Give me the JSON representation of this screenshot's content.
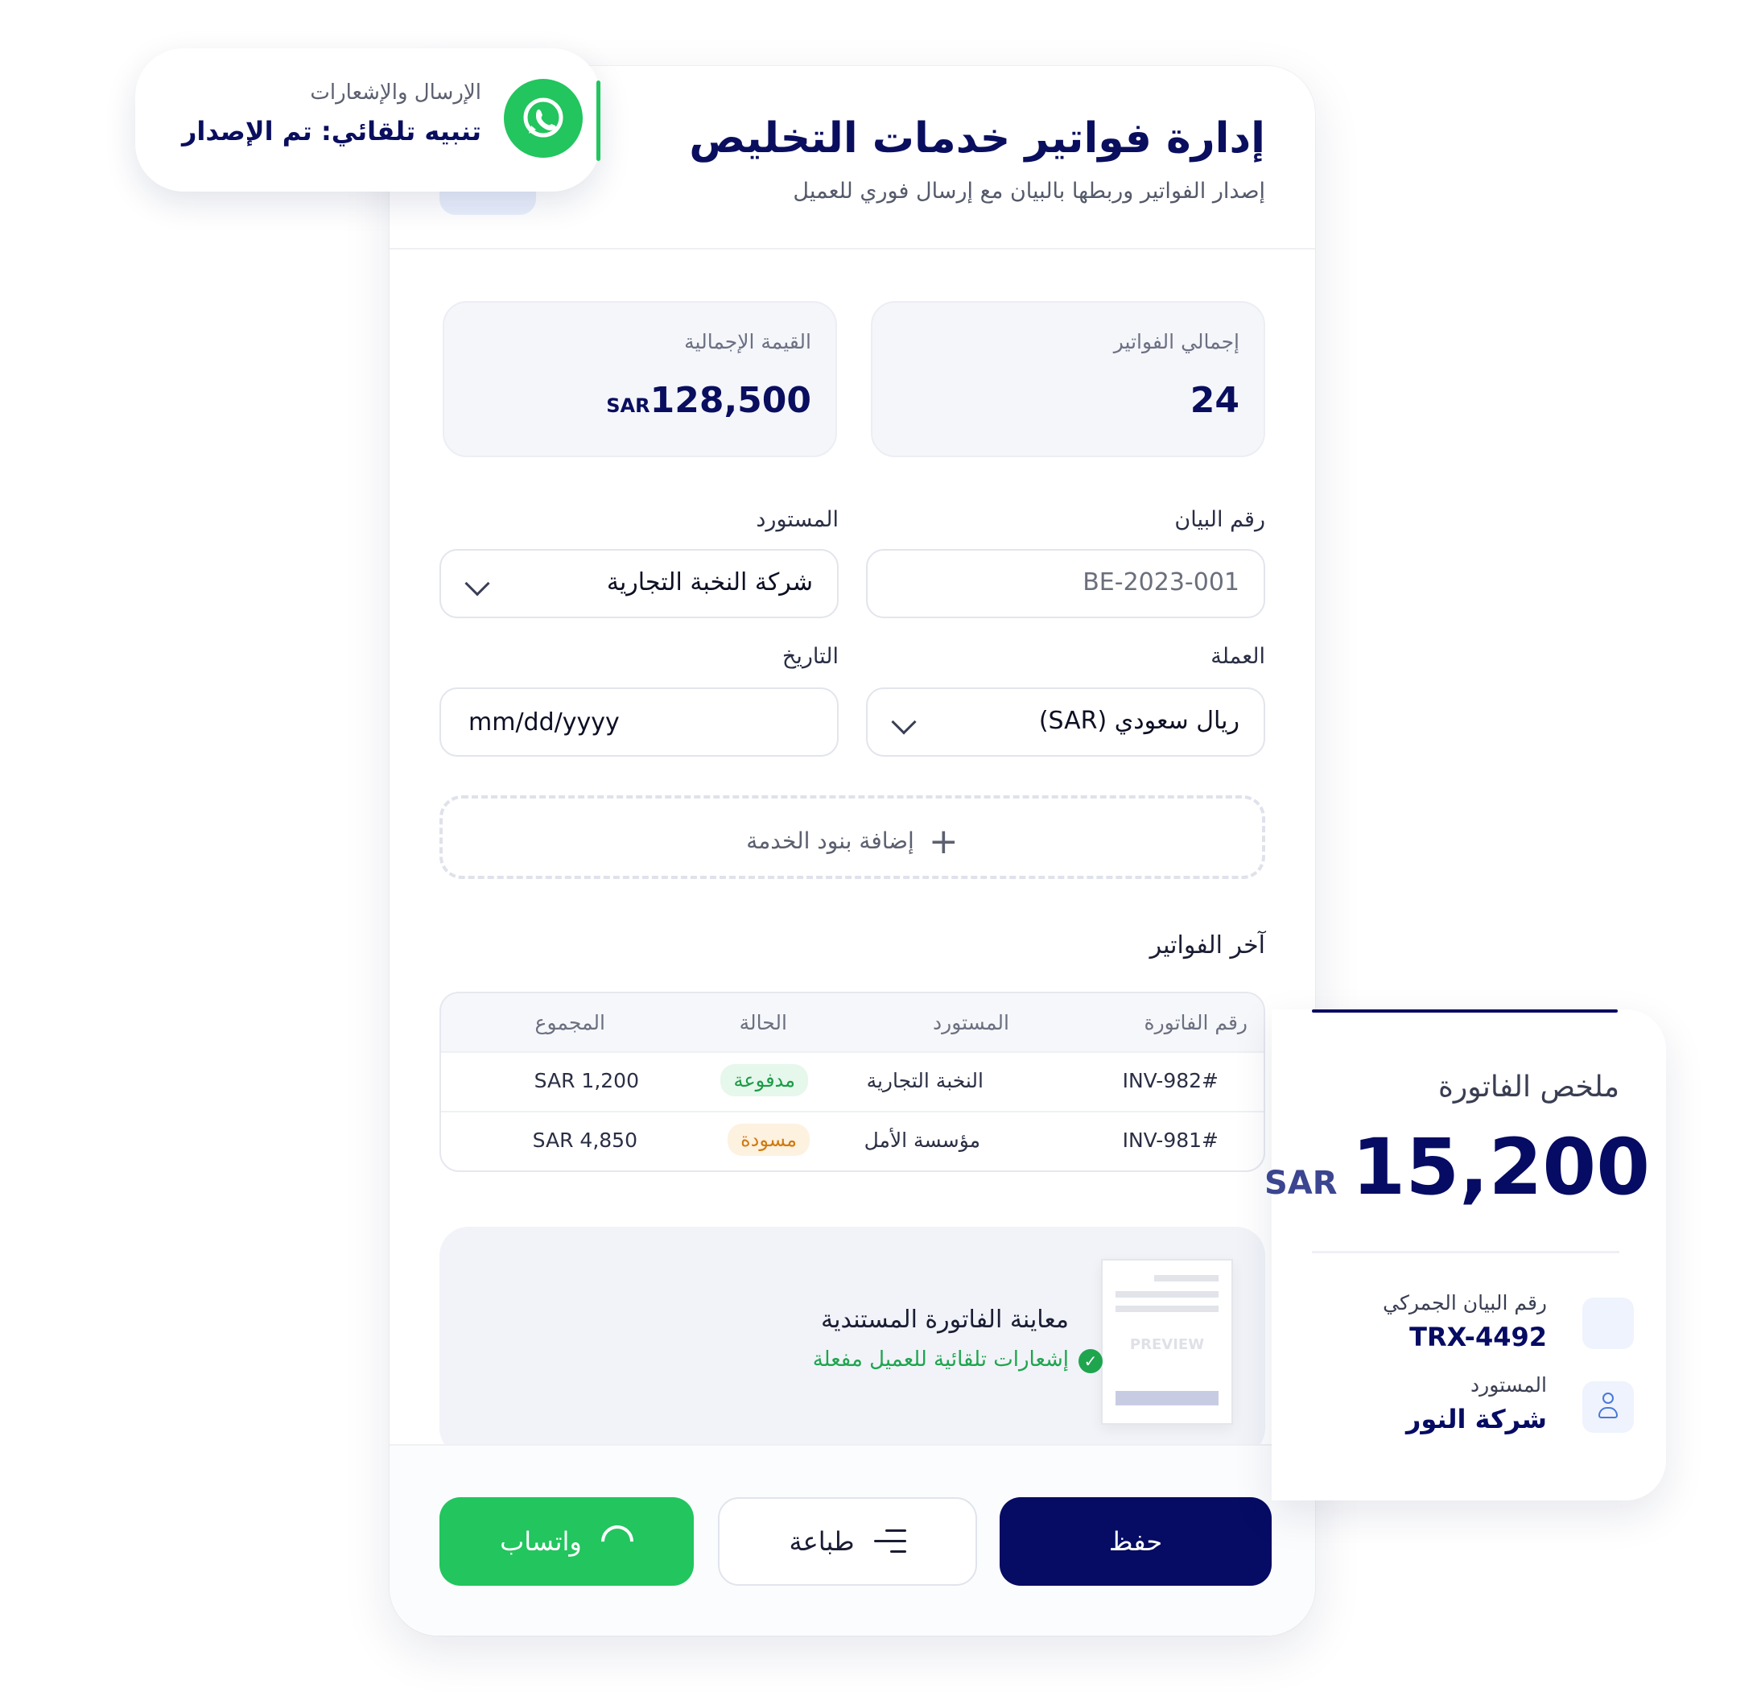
{
  "notification": {
    "label": "الإرسال والإشعارات",
    "title": "تنبيه تلقائي: تم الإصدار",
    "icon": "whatsapp-icon"
  },
  "header": {
    "title": "إدارة فواتير خدمات التخليص",
    "subtitle": "إصدار الفواتير وربطها بالبيان مع إرسال فوري للعميل"
  },
  "stats": {
    "total_invoices": {
      "label": "إجمالي الفواتير",
      "value": "24"
    },
    "total_value": {
      "label": "القيمة الإجمالية",
      "value": "128,500",
      "unit": "SAR"
    }
  },
  "form": {
    "declaration": {
      "label": "رقم البيان",
      "placeholder": "BE-2023-001"
    },
    "importer": {
      "label": "المستورد",
      "value": "شركة النخبة التجارية"
    },
    "currency": {
      "label": "العملة",
      "value": "ريال سعودي (SAR)"
    },
    "date": {
      "label": "التاريخ",
      "value": "mm/dd/yyyy"
    },
    "add_items": "إضافة بنود الخدمة"
  },
  "recent": {
    "title": "آخر الفواتير",
    "columns": [
      "رقم الفاتورة",
      "المستورد",
      "الحالة",
      "المجموع"
    ],
    "rows": [
      {
        "id": "#INV-982",
        "importer": "النخبة التجارية",
        "status": "مدفوعة",
        "total": "1,200 SAR"
      },
      {
        "id": "#INV-981",
        "importer": "مؤسسة الأمل",
        "status": "مسودة",
        "total": "4,850 SAR"
      }
    ]
  },
  "preview": {
    "title": "معاينة الفاتورة المستندية",
    "note": "إشعارات تلقائية للعميل مفعلة",
    "doc_label": "PREVIEW"
  },
  "actions": {
    "save": "حفظ",
    "print": "طباعة",
    "whatsapp": "واتساب"
  },
  "summary": {
    "title": "ملخص الفاتورة",
    "amount": "15,200",
    "currency": "SAR",
    "customs_label": "رقم البيان الجمركي",
    "customs_value": "TRX-4492",
    "importer_label": "المستورد",
    "importer_value": "شركة النور"
  },
  "colors": {
    "primary": "#060b63",
    "accent_green": "#22c55e",
    "paid": "#1b9a45",
    "draft": "#d07a10"
  }
}
